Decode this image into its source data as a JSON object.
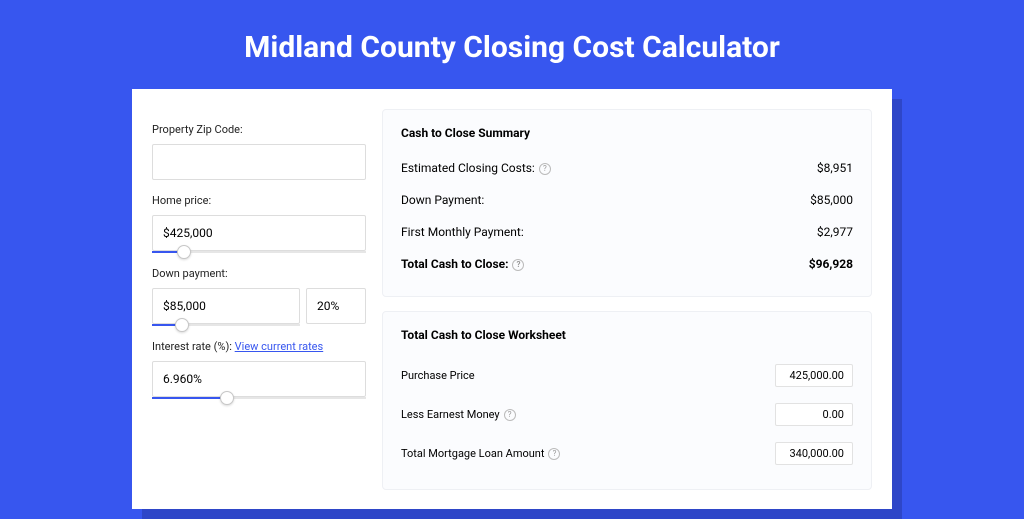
{
  "title": "Midland County Closing Cost Calculator",
  "left": {
    "zip_label": "Property Zip Code:",
    "zip_value": "",
    "price_label": "Home price:",
    "price_value": "$425,000",
    "price_pct": 15,
    "down_label": "Down payment:",
    "down_value": "$85,000",
    "down_pct_value": "20%",
    "down_slider_pct": 20,
    "rate_label": "Interest rate (%):",
    "rate_link": "View current rates",
    "rate_value": "6.960%",
    "rate_slider_pct": 35
  },
  "summary": {
    "heading": "Cash to Close Summary",
    "rows": [
      {
        "label": "Estimated Closing Costs:",
        "help": true,
        "value": "$8,951",
        "bold": false
      },
      {
        "label": "Down Payment:",
        "help": false,
        "value": "$85,000",
        "bold": false
      },
      {
        "label": "First Monthly Payment:",
        "help": false,
        "value": "$2,977",
        "bold": false
      },
      {
        "label": "Total Cash to Close:",
        "help": true,
        "value": "$96,928",
        "bold": true
      }
    ]
  },
  "worksheet": {
    "heading": "Total Cash to Close Worksheet",
    "rows": [
      {
        "label": "Purchase Price",
        "help": false,
        "value": "425,000.00"
      },
      {
        "label": "Less Earnest Money",
        "help": true,
        "value": "0.00"
      },
      {
        "label": "Total Mortgage Loan Amount",
        "help": true,
        "value": "340,000.00"
      }
    ]
  }
}
